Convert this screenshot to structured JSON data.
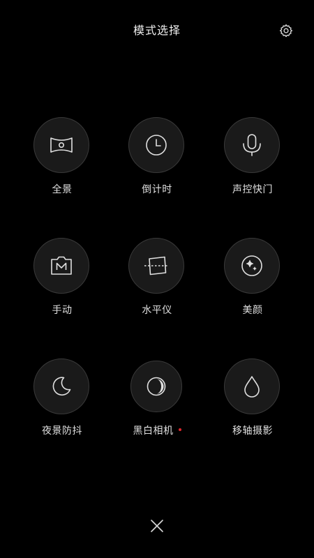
{
  "header": {
    "title": "模式选择",
    "settings_icon": "gear-icon"
  },
  "modes": [
    {
      "label": "全景",
      "icon": "panorama-icon"
    },
    {
      "label": "倒计时",
      "icon": "clock-icon"
    },
    {
      "label": "声控快门",
      "icon": "microphone-icon"
    },
    {
      "label": "手动",
      "icon": "manual-m-icon"
    },
    {
      "label": "水平仪",
      "icon": "level-icon"
    },
    {
      "label": "美颜",
      "icon": "sparkle-icon"
    },
    {
      "label": "夜景防抖",
      "icon": "moon-icon"
    },
    {
      "label": "黑白相机",
      "icon": "half-moon-icon",
      "badge": "new-dot"
    },
    {
      "label": "移轴摄影",
      "icon": "drop-icon"
    }
  ],
  "footer": {
    "close_icon": "close-icon"
  },
  "colors": {
    "background": "#000000",
    "circle_fill": "#1a1a1a",
    "circle_border": "#3a3a3a",
    "text": "#e0e0e0",
    "badge": "#e0282e"
  }
}
